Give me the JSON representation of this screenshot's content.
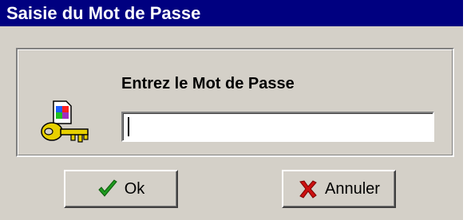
{
  "window": {
    "title": "Saisie du Mot de Passe"
  },
  "dialog": {
    "prompt_label": "Entrez le Mot de Passe",
    "password_value": "",
    "key_icon": "key-icon"
  },
  "buttons": {
    "ok_label": "Ok",
    "ok_icon": "checkmark-icon",
    "cancel_label": "Annuler",
    "cancel_icon": "x-icon"
  },
  "colors": {
    "titlebar": "#000080",
    "face": "#d4d0c8",
    "ok_check": "#1f9a1f",
    "cancel_x": "#cc1010"
  }
}
